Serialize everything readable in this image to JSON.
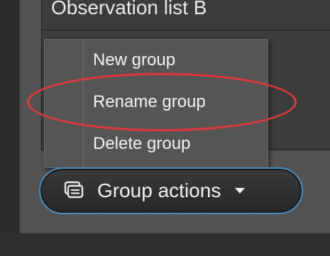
{
  "list": {
    "title": "Observation list B"
  },
  "context_menu": {
    "items": [
      {
        "label": "New group"
      },
      {
        "label": "Rename group"
      },
      {
        "label": "Delete group"
      }
    ],
    "highlighted_index": 1,
    "highlight_color": "#e0393c"
  },
  "group_actions": {
    "label": "Group actions",
    "icon": "group-icon",
    "caret_icon": "caret-down-icon",
    "focus_color": "#4a8fc4"
  }
}
